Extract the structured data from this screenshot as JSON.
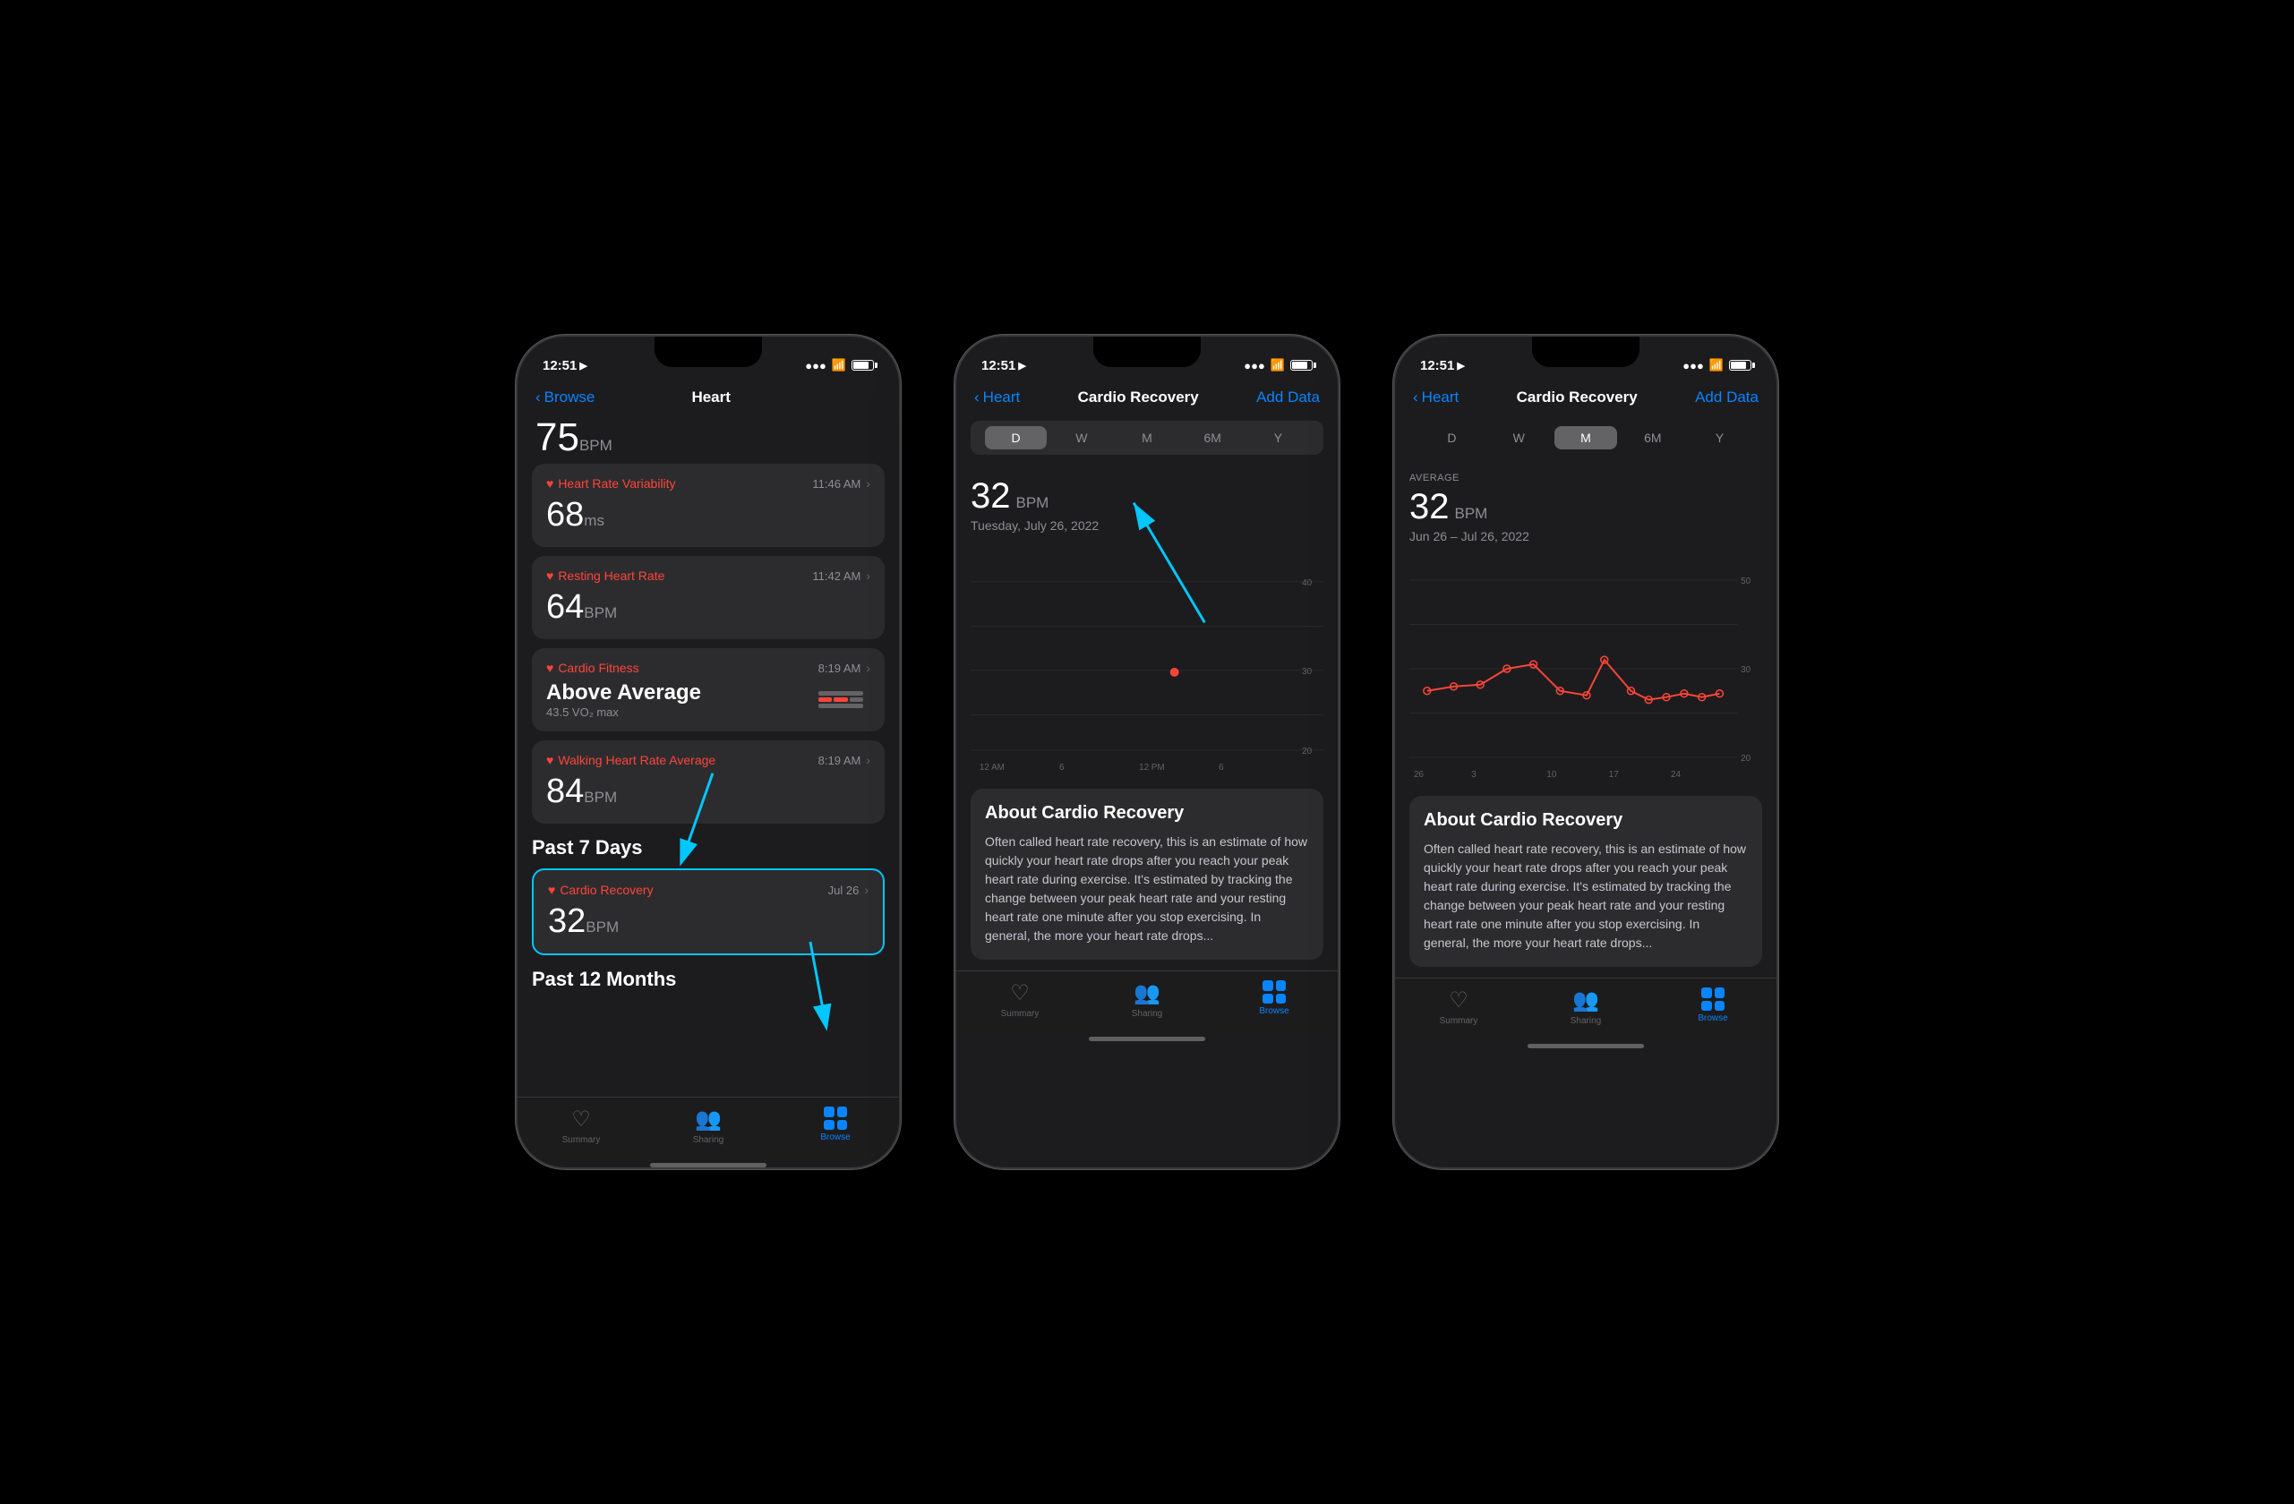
{
  "phones": [
    {
      "id": "phone1",
      "statusBar": {
        "time": "12:51",
        "signal": "●●●●",
        "wifi": "wifi",
        "battery": "battery"
      },
      "nav": {
        "back": "Browse",
        "title": "Heart",
        "action": null
      },
      "partialValue": "75",
      "partialUnit": "BPM",
      "cards": [
        {
          "title": "Heart Rate Variability",
          "time": "11:46 AM",
          "value": "68",
          "unit": "ms",
          "highlighted": false
        },
        {
          "title": "Resting Heart Rate",
          "time": "11:42 AM",
          "value": "64",
          "unit": "BPM",
          "highlighted": false
        },
        {
          "title": "Cardio Fitness",
          "time": "8:19 AM",
          "value": "Above Average",
          "unit": "",
          "subvalue": "43.5 VO₂ max",
          "highlighted": false
        },
        {
          "title": "Walking Heart Rate Average",
          "time": "8:19 AM",
          "value": "84",
          "unit": "BPM",
          "highlighted": false
        }
      ],
      "sectionLabel": "Past 7 Days",
      "recoveryCard": {
        "title": "Cardio Recovery",
        "time": "Jul 26",
        "value": "32",
        "unit": "BPM",
        "highlighted": true
      },
      "section2Label": "Past 12 Months",
      "tabs": [
        {
          "label": "Summary",
          "icon": "heart",
          "active": false
        },
        {
          "label": "Sharing",
          "icon": "sharing",
          "active": false
        },
        {
          "label": "Browse",
          "icon": "browse",
          "active": true
        }
      ]
    },
    {
      "id": "phone2",
      "statusBar": {
        "time": "12:51",
        "signal": "●●●●",
        "wifi": "wifi",
        "battery": "battery"
      },
      "nav": {
        "back": "Heart",
        "title": "Cardio Recovery",
        "action": "Add Data"
      },
      "timePeriods": [
        "D",
        "W",
        "M",
        "6M",
        "Y"
      ],
      "activeTimePeriod": "D",
      "chartValue": "32",
      "chartUnit": "BPM",
      "chartDate": "Tuesday, July 26, 2022",
      "chartAvgLabel": null,
      "chartDateRange": null,
      "about": {
        "title": "About Cardio Recovery",
        "text": "Often called heart rate recovery, this is an estimate of how quickly your heart rate drops after you reach your peak heart rate during exercise. It's estimated by tracking the change between your peak heart rate and your resting heart rate one minute after you stop exercising. In general, the more your heart rate drops..."
      },
      "tabs": [
        {
          "label": "Summary",
          "icon": "heart",
          "active": false
        },
        {
          "label": "Sharing",
          "icon": "sharing",
          "active": false
        },
        {
          "label": "Browse",
          "icon": "browse",
          "active": true
        }
      ]
    },
    {
      "id": "phone3",
      "statusBar": {
        "time": "12:51",
        "signal": "●●●●",
        "wifi": "wifi",
        "battery": "battery"
      },
      "nav": {
        "back": "Heart",
        "title": "Cardio Recovery",
        "action": "Add Data"
      },
      "timePeriods": [
        "D",
        "W",
        "M",
        "6M",
        "Y"
      ],
      "activeTimePeriod": "M",
      "chartAvgLabel": "AVERAGE",
      "chartValue": "32",
      "chartUnit": "BPM",
      "chartDate": null,
      "chartDateRange": "Jun 26 – Jul 26, 2022",
      "about": {
        "title": "About Cardio Recovery",
        "text": "Often called heart rate recovery, this is an estimate of how quickly your heart rate drops after you reach your peak heart rate during exercise. It's estimated by tracking the change between your peak heart rate and your resting heart rate one minute after you stop exercising. In general, the more your heart rate drops..."
      },
      "tabs": [
        {
          "label": "Summary",
          "icon": "heart",
          "active": false
        },
        {
          "label": "Sharing",
          "icon": "sharing",
          "active": false
        },
        {
          "label": "Browse",
          "icon": "browse",
          "active": true
        }
      ]
    }
  ],
  "colors": {
    "accent": "#0a84ff",
    "heartRed": "#ff453a",
    "cyan": "#00c7ff",
    "cardBg": "#2c2c2e",
    "screenBg": "#1c1c1e"
  }
}
